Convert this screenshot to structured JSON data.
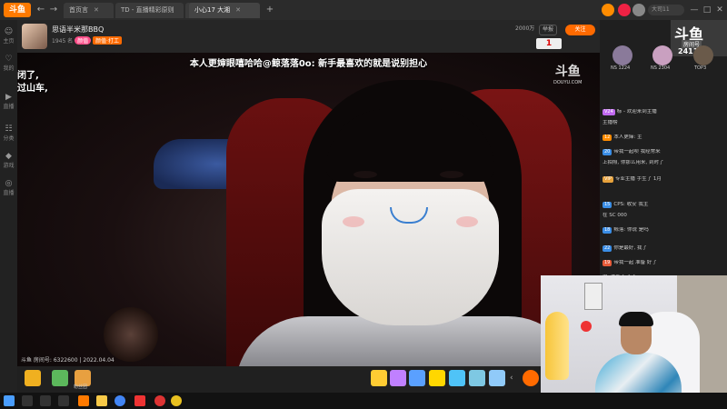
{
  "titlebar": {
    "logo": "斗鱼",
    "tabs": [
      {
        "label": "首页言"
      },
      {
        "label": "TD - 直播精彩原则"
      },
      {
        "label": "夜"
      },
      {
        "label": "小心17 大湘"
      }
    ],
    "nav": {
      "back": "←",
      "forward": "→",
      "refresh": "⟳"
    },
    "search_placeholder": "大司11",
    "window_controls": {
      "min": "—",
      "max": "□",
      "close": "✕"
    }
  },
  "sidebar": {
    "items": [
      {
        "label": "主页",
        "glyph": "☺"
      },
      {
        "label": "我的",
        "glyph": "♡"
      },
      {
        "label": "直播",
        "glyph": "▶"
      },
      {
        "label": "分类",
        "glyph": "☷"
      },
      {
        "label": "游戏",
        "glyph": "◆"
      },
      {
        "label": "直播",
        "glyph": "◎"
      }
    ]
  },
  "room": {
    "title": "思语半米那BBQ",
    "meta_rank": "1945 名",
    "meta_tag": "颜值",
    "badge_pink": "颜值",
    "badge_orange": "颜值·打工",
    "hot": "2000万",
    "select1": "举报",
    "select2": "分享",
    "follow": "关注",
    "count": "1"
  },
  "video": {
    "danmu_main": "本人更婶眼嘻哈哈@鲸落落0o: 新手最喜欢的就是说别担心",
    "danmu_left_1": "闭了,",
    "danmu_left_2": "过山车,",
    "watermark": "斗鱼",
    "watermark_sub": "DOUYU.COM",
    "info": "斗鱼 房间号: 6322600 | 2022.04.04"
  },
  "gifts": [
    {
      "label": "",
      "color": "#f0b020"
    },
    {
      "label": "",
      "color": "#5cb85c"
    },
    {
      "label": "粉丝团",
      "color": "#e8a040"
    }
  ],
  "chat": {
    "promo_big": "斗鱼",
    "promo_label": "房间号",
    "promo_num": "241123",
    "ranks": [
      {
        "name": "NS 1224"
      },
      {
        "name": "NS 2304"
      },
      {
        "name": "TOP3"
      }
    ],
    "lines": [
      {
        "lvl": "V24",
        "lvlc": "#c06af0",
        "text": "标 - 欢迎来到主播"
      },
      {
        "lvl": "",
        "lvlc": "#333",
        "text": "主播榜"
      },
      {
        "lvl": "12",
        "lvlc": "#ff8c00",
        "text": "本人更婶: 主"
      },
      {
        "lvl": "20",
        "lvlc": "#3a8ee6",
        "text": "带我一起呗 我经常来"
      },
      {
        "lvl": "",
        "lvlc": "#333",
        "text": "上拍照, 你那么用来, 到时了"
      },
      {
        "lvl": "VIP",
        "lvlc": "#e6a23c",
        "text": "专业主播 手生了 1月"
      },
      {
        "lvl": "15",
        "lvlc": "#3a8ee6",
        "text": "CPS: 收安 我主"
      },
      {
        "lvl": "",
        "lvlc": "#333",
        "text": "在 SC 000"
      },
      {
        "lvl": "18",
        "lvlc": "#3a8ee6",
        "text": "鲸落: 你说 是吗"
      },
      {
        "lvl": "22",
        "lvlc": "#3a8ee6",
        "text": "你是最好, 我了"
      },
      {
        "lvl": "19",
        "lvlc": "#e65c3a",
        "text": "带我一起 准备 好了"
      },
      {
        "lvl": "",
        "lvlc": "#333",
        "text": "保, 准备不了了"
      },
      {
        "lvl": "21",
        "lvlc": "#e65c3a",
        "text": "一起玩 说别担心"
      }
    ]
  }
}
